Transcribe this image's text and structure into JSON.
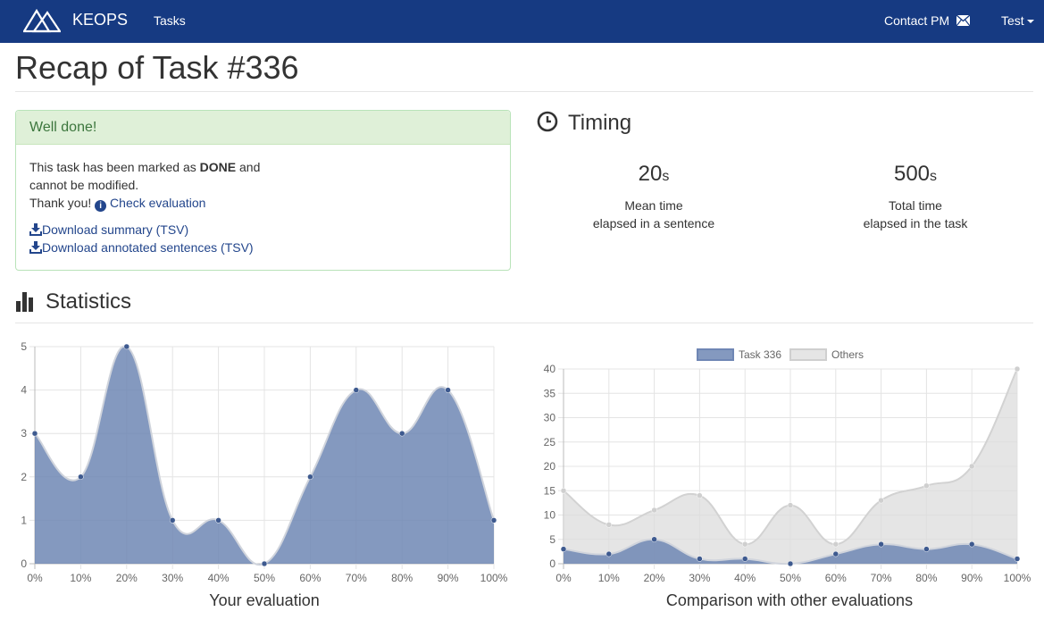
{
  "navbar": {
    "brand": "KEOPS",
    "tasks_link": "Tasks",
    "contact_link": "Contact PM",
    "user_menu": "Test"
  },
  "page": {
    "title": "Recap of Task #336"
  },
  "alert": {
    "heading": "Well done!",
    "line1_pre": "This task has been marked as ",
    "line1_bold": "DONE",
    "line1_post": " and",
    "line2": "cannot be modified.",
    "line3": "Thank you!",
    "check_link": "Check evaluation",
    "download_summary": "Download summary (TSV)",
    "download_annotated": "Download annotated sentences (TSV)"
  },
  "timing": {
    "title": "Timing",
    "mean": {
      "value": "20",
      "unit": "s",
      "label1": "Mean time",
      "label2": "elapsed in a sentence"
    },
    "total": {
      "value": "500",
      "unit": "s",
      "label1": "Total time",
      "label2": "elapsed in the task"
    }
  },
  "statistics": {
    "title": "Statistics"
  },
  "colors": {
    "navbar": "#163a82",
    "task_series": "#7d93bc",
    "others_series": "#e6e6e6",
    "alert_bg": "#dff0d8"
  },
  "chart_data": [
    {
      "type": "area",
      "title": "Your evaluation",
      "categories": [
        "0%",
        "10%",
        "20%",
        "30%",
        "40%",
        "50%",
        "60%",
        "70%",
        "80%",
        "90%",
        "100%"
      ],
      "values": [
        3,
        2,
        5,
        1,
        1,
        0,
        2,
        4,
        3,
        4,
        1
      ],
      "ylim": [
        0,
        5
      ],
      "yticks": [
        "0",
        "1",
        "2",
        "3",
        "4",
        "5"
      ],
      "grid": true
    },
    {
      "type": "area",
      "title": "Comparison with other evaluations",
      "categories": [
        "0%",
        "10%",
        "20%",
        "30%",
        "40%",
        "50%",
        "60%",
        "70%",
        "80%",
        "90%",
        "100%"
      ],
      "series": [
        {
          "name": "Task 336",
          "values": [
            3,
            2,
            5,
            1,
            1,
            0,
            2,
            4,
            3,
            4,
            1
          ]
        },
        {
          "name": "Others",
          "values": [
            15,
            8,
            11,
            14,
            4,
            12,
            4,
            13,
            16,
            20,
            40
          ]
        }
      ],
      "ylim": [
        0,
        40
      ],
      "yticks": [
        "0",
        "5",
        "10",
        "15",
        "20",
        "25",
        "30",
        "35",
        "40"
      ],
      "legend": "top",
      "grid": true
    }
  ]
}
